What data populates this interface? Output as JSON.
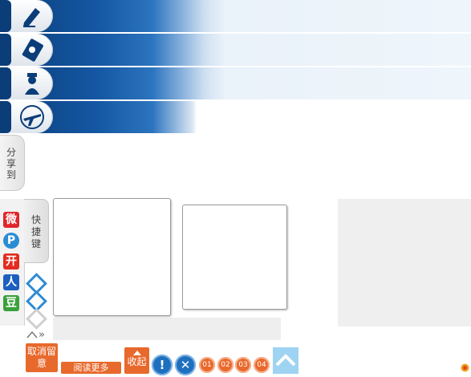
{
  "share_tab_label": "分享到",
  "quick_tab_label": "快捷键",
  "social_items": [
    {
      "name": "weibo",
      "glyph": "微",
      "color": "#e0242b"
    },
    {
      "name": "tencent-weibo",
      "glyph": "P",
      "color": "#2a8dd4"
    },
    {
      "name": "kaixin",
      "glyph": "开",
      "color": "#e32c1f"
    },
    {
      "name": "renren",
      "glyph": "人",
      "color": "#1d5fbf"
    },
    {
      "name": "douban",
      "glyph": "豆",
      "color": "#3ba03c"
    }
  ],
  "toolbar": {
    "cancel_label": "取消留意",
    "read_more_label": "阅读更多",
    "collapse_label": "收起",
    "alert_glyph": "!",
    "close_glyph": "✕",
    "nums": [
      "01",
      "02",
      "03",
      "04"
    ]
  },
  "nav_arrows": "»",
  "colors": {
    "accent": "#e8692c",
    "brand_dark": "#0b3d79",
    "blue": "#2f8bd3"
  }
}
